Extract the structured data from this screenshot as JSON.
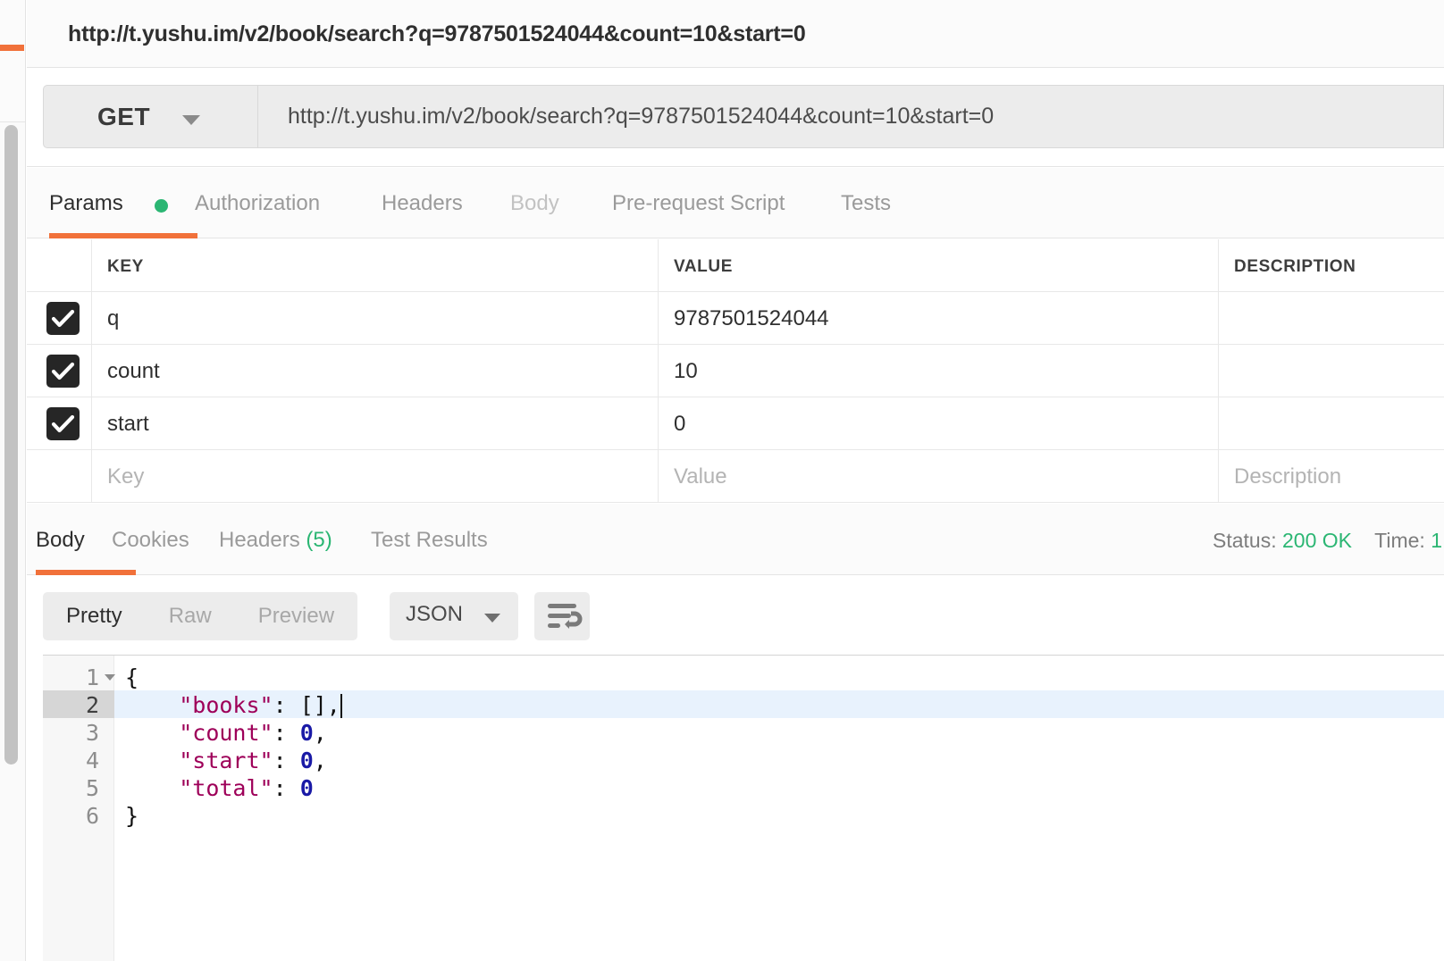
{
  "request": {
    "title": "http://t.yushu.im/v2/book/search?q=9787501524044&count=10&start=0",
    "method": "GET",
    "url": "http://t.yushu.im/v2/book/search?q=9787501524044&count=10&start=0"
  },
  "request_tabs": [
    {
      "label": "Params",
      "state": "active",
      "has_dot": true
    },
    {
      "label": "Authorization",
      "state": "normal",
      "has_dot": false
    },
    {
      "label": "Headers",
      "state": "normal",
      "has_dot": false
    },
    {
      "label": "Body",
      "state": "muted",
      "has_dot": false
    },
    {
      "label": "Pre-request Script",
      "state": "normal",
      "has_dot": false
    },
    {
      "label": "Tests",
      "state": "normal",
      "has_dot": false
    }
  ],
  "params_table": {
    "headers": [
      "KEY",
      "VALUE",
      "DESCRIPTION"
    ],
    "rows": [
      {
        "checked": true,
        "key": "q",
        "value": "9787501524044",
        "description": ""
      },
      {
        "checked": true,
        "key": "count",
        "value": "10",
        "description": ""
      },
      {
        "checked": true,
        "key": "start",
        "value": "0",
        "description": ""
      }
    ],
    "new_row_placeholders": {
      "key": "Key",
      "value": "Value",
      "description": "Description"
    }
  },
  "response_tabs": [
    {
      "label": "Body",
      "count": "",
      "state": "active"
    },
    {
      "label": "Cookies",
      "count": "",
      "state": "normal"
    },
    {
      "label": "Headers",
      "count": "(5)",
      "state": "normal"
    },
    {
      "label": "Test Results",
      "count": "",
      "state": "normal"
    }
  ],
  "response_meta": {
    "status_label": "Status:",
    "status_value": "200 OK",
    "time_label": "Time:",
    "time_value": "1"
  },
  "format_bar": {
    "views": [
      {
        "label": "Pretty",
        "state": "active"
      },
      {
        "label": "Raw",
        "state": "normal"
      },
      {
        "label": "Preview",
        "state": "normal"
      }
    ],
    "type": "JSON",
    "wrap_icon": "word-wrap-icon"
  },
  "code": {
    "lines": [
      {
        "no": "1",
        "indent": 0,
        "foldable": true,
        "highlighted": false,
        "cursor": false,
        "segments": [
          {
            "t": "{",
            "c": "punc"
          }
        ]
      },
      {
        "no": "2",
        "indent": 1,
        "foldable": false,
        "highlighted": true,
        "cursor": true,
        "segments": [
          {
            "t": "\"books\"",
            "c": "key"
          },
          {
            "t": ": ",
            "c": "punc"
          },
          {
            "t": "[]",
            "c": "punc"
          },
          {
            "t": ",",
            "c": "punc"
          }
        ]
      },
      {
        "no": "3",
        "indent": 1,
        "foldable": false,
        "highlighted": false,
        "cursor": false,
        "segments": [
          {
            "t": "\"count\"",
            "c": "key"
          },
          {
            "t": ": ",
            "c": "punc"
          },
          {
            "t": "0",
            "c": "num"
          },
          {
            "t": ",",
            "c": "punc"
          }
        ]
      },
      {
        "no": "4",
        "indent": 1,
        "foldable": false,
        "highlighted": false,
        "cursor": false,
        "segments": [
          {
            "t": "\"start\"",
            "c": "key"
          },
          {
            "t": ": ",
            "c": "punc"
          },
          {
            "t": "0",
            "c": "num"
          },
          {
            "t": ",",
            "c": "punc"
          }
        ]
      },
      {
        "no": "5",
        "indent": 1,
        "foldable": false,
        "highlighted": false,
        "cursor": false,
        "segments": [
          {
            "t": "\"total\"",
            "c": "key"
          },
          {
            "t": ": ",
            "c": "punc"
          },
          {
            "t": "0",
            "c": "num"
          }
        ]
      },
      {
        "no": "6",
        "indent": 0,
        "foldable": false,
        "highlighted": false,
        "cursor": false,
        "segments": [
          {
            "t": "}",
            "c": "punc"
          }
        ]
      }
    ]
  },
  "colors": {
    "accent_orange": "#f1713a",
    "success_green": "#2bb673",
    "json_key": "#9e0059",
    "json_number": "#1a1aa6",
    "line_highlight": "#e8f2fd"
  }
}
